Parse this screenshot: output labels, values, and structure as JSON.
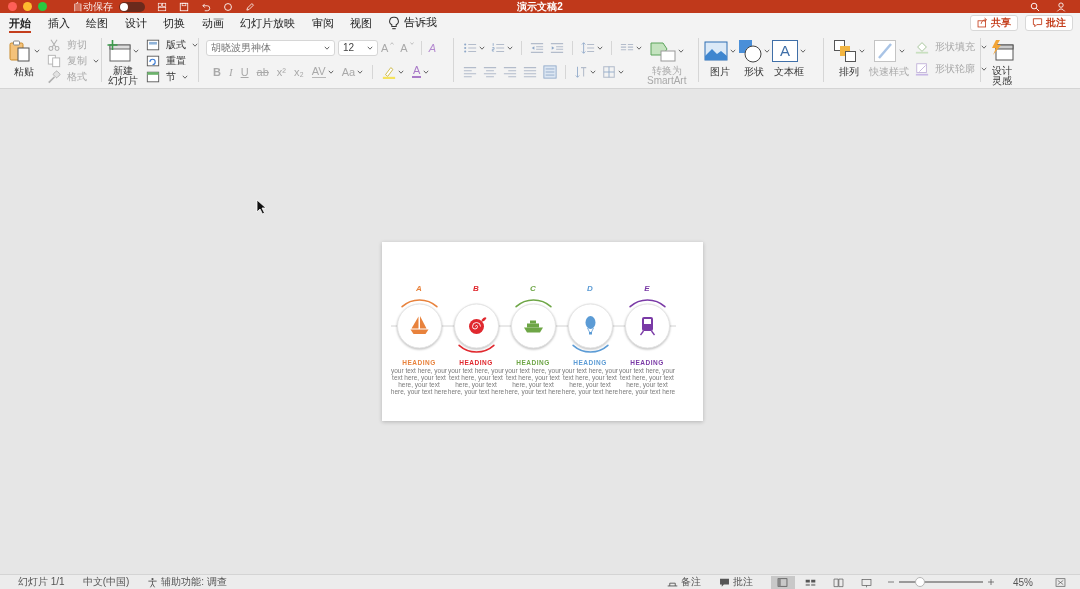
{
  "window": {
    "autosave": "自动保存",
    "autosave_on": false,
    "title": "演示文稿2"
  },
  "tabs": [
    {
      "label": "开始",
      "selected": true
    },
    {
      "label": "插入",
      "selected": false
    },
    {
      "label": "绘图",
      "selected": false
    },
    {
      "label": "设计",
      "selected": false
    },
    {
      "label": "切换",
      "selected": false
    },
    {
      "label": "动画",
      "selected": false
    },
    {
      "label": "幻灯片放映",
      "selected": false
    },
    {
      "label": "审阅",
      "selected": false
    },
    {
      "label": "视图",
      "selected": false
    }
  ],
  "tell_me": "告诉我",
  "share_button": "共享",
  "comments_button": "批注",
  "ribbon": {
    "paste": "粘贴",
    "clipboard_tools": [
      {
        "label": "剪切",
        "disabled": true,
        "dropdown": false
      },
      {
        "label": "复制",
        "disabled": true,
        "dropdown": true
      },
      {
        "label": "格式",
        "disabled": true,
        "dropdown": false
      }
    ],
    "new_slide": [
      "新建",
      "幻灯片"
    ],
    "slide_tools": [
      {
        "label": "版式",
        "dropdown": true
      },
      {
        "label": "重置",
        "dropdown": false
      },
      {
        "label": "节",
        "dropdown": true
      }
    ],
    "font_name": "胡晓波男神体",
    "font_size": "12",
    "font_size_buttons": [
      {
        "label": "A",
        "kind": "grow"
      },
      {
        "label": "A",
        "kind": "shrink"
      }
    ],
    "clear_format": "A",
    "font_styles": [
      {
        "label": "B",
        "kind": "bold",
        "dropdown": false
      },
      {
        "label": "I",
        "kind": "italic",
        "dropdown": false
      },
      {
        "label": "U",
        "kind": "underline",
        "dropdown": false
      },
      {
        "label": "ab",
        "kind": "strike",
        "dropdown": false
      },
      {
        "label": "x²",
        "kind": "plain",
        "dropdown": false
      },
      {
        "label": "x₂",
        "kind": "plain",
        "dropdown": false
      },
      {
        "label": "AV",
        "kind": "spacing",
        "dropdown": true
      },
      {
        "label": "Aa",
        "kind": "plain",
        "dropdown": true
      }
    ],
    "font_color": "A",
    "smartart": {
      "label": [
        "转换为",
        "SmartArt"
      ],
      "disabled": true
    },
    "picture": "图片",
    "shapes": "形状",
    "textbox": {
      "label": "文本框",
      "glyph": "A"
    },
    "arrange": "排列",
    "quick_styles": {
      "label": "快速样式",
      "disabled": true
    },
    "shape_tools": [
      {
        "label": "形状填充",
        "disabled": true
      },
      {
        "label": "形状轮廓",
        "disabled": true
      }
    ],
    "design_ideas": [
      "设计",
      "灵感"
    ]
  },
  "slide": {
    "items": [
      {
        "letter": "A",
        "heading": "HEADING",
        "body": "your text here, your text here, your text here, your text here, your text here",
        "color": "#e8823c",
        "arc_top": true
      },
      {
        "letter": "B",
        "heading": "HEADING",
        "body": "your text here, your text here, your text here, your text here, your text here",
        "color": "#e0282e",
        "arc_top": false
      },
      {
        "letter": "C",
        "heading": "HEADING",
        "body": "your text here, your text here, your text here, your text here, your text here",
        "color": "#6ea646",
        "arc_top": true
      },
      {
        "letter": "D",
        "heading": "HEADING",
        "body": "your text here, your text here, your text here, your text here, your text here",
        "color": "#5b9bd5",
        "arc_top": false
      },
      {
        "letter": "E",
        "heading": "HEADING",
        "body": "your text here, your text here, your text here, your text here, your text here",
        "color": "#7a3aa6",
        "arc_top": true
      }
    ]
  },
  "status_bar": {
    "slide_count": "幻灯片 1/1",
    "language": "中文(中国)",
    "accessibility": "辅助功能: 调查",
    "notes": "备注",
    "comments": "批注",
    "views": [
      {
        "selected": true
      },
      {
        "selected": false
      },
      {
        "selected": false
      },
      {
        "selected": false
      }
    ],
    "zoom": {
      "level": 0.25,
      "reading": "45%"
    }
  }
}
